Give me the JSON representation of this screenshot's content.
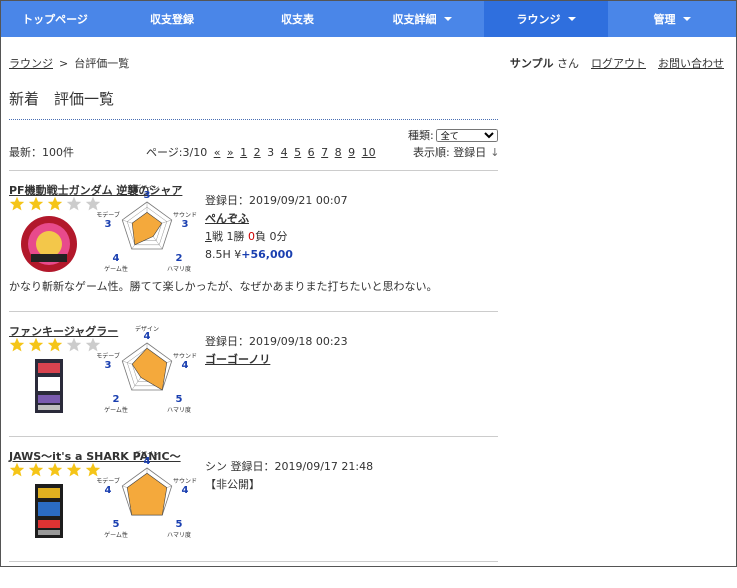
{
  "nav": {
    "items": [
      {
        "label": "トップページ",
        "has_caret": false,
        "active": false
      },
      {
        "label": "収支登録",
        "has_caret": false,
        "active": false
      },
      {
        "label": "収支表",
        "has_caret": false,
        "active": false
      },
      {
        "label": "収支詳細",
        "has_caret": true,
        "active": false
      },
      {
        "label": "ラウンジ",
        "has_caret": true,
        "active": true
      },
      {
        "label": "管理",
        "has_caret": true,
        "active": false
      }
    ],
    "color": "#4a86e8",
    "active_color": "#2f6fde"
  },
  "breadcrumb": {
    "parent": "ラウンジ",
    "separator": ">",
    "current": "台評価一覧"
  },
  "user": {
    "name": "サンプル",
    "suffix": " さん",
    "logout": "ログアウト",
    "contact": "お問い合わせ"
  },
  "page_title": "新着　評価一覧",
  "filter": {
    "label": "種類:",
    "selected": "全て"
  },
  "count_label": "最新：100件",
  "pager": {
    "label": "ページ:3/10",
    "first": "«",
    "prev": "»",
    "pages": [
      "1",
      "2"
    ],
    "current": "3",
    "after": [
      "4",
      "5",
      "6",
      "7",
      "8",
      "9",
      "10"
    ]
  },
  "sort": {
    "label": "表示順: 登録日",
    "arrow": "↓"
  },
  "radar_labels": {
    "top": "デザイン",
    "right": "サウンド",
    "bottom_right": "ハマリ度",
    "bottom_left": "ゲーム性",
    "left": "モデーブ"
  },
  "reviews": [
    {
      "title": "PF機動戦士ガンダム 逆襲のシャア",
      "stars": 3,
      "thumb_icon": "pachinko-machine-icon",
      "scores": {
        "design": "3",
        "sound": "3",
        "hamari": "2",
        "game": "4",
        "mode": "3"
      },
      "date_line": "登録日：2019/09/21 00:07",
      "user": "ぺんぞふ",
      "record_link": "1",
      "record_rest_a": "戦 1勝 ",
      "record_loss": "0",
      "record_rest_b": "負 0分",
      "money_prefix": "8.5H ¥",
      "money": "+56,000",
      "comment": "かなり斬新なゲーム性。勝てて楽しかったが、なぜかあまりまた打ちたいと思わない。"
    },
    {
      "title": "ファンキージャグラー",
      "stars": 3,
      "thumb_icon": "slot-machine-icon",
      "scores": {
        "design": "4",
        "sound": "4",
        "hamari": "5",
        "game": "2",
        "mode": "3"
      },
      "date_line": "登録日：2019/09/18 00:23",
      "user": "ゴーゴーノリ"
    },
    {
      "title": "JAWS〜it's a SHARK PANIC〜",
      "stars": 5,
      "thumb_icon": "slot-machine-icon",
      "scores": {
        "design": "4",
        "sound": "4",
        "hamari": "5",
        "game": "5",
        "mode": "4"
      },
      "date_line": "シン 登録日：2019/09/17 21:48",
      "status": "【非公開】"
    }
  ],
  "colors": {
    "star_on": "#f5c518",
    "star_off": "#cccccc",
    "radar_fill": "#f4a93c",
    "score": "#1a3fb0",
    "loss": "#cc0000"
  }
}
